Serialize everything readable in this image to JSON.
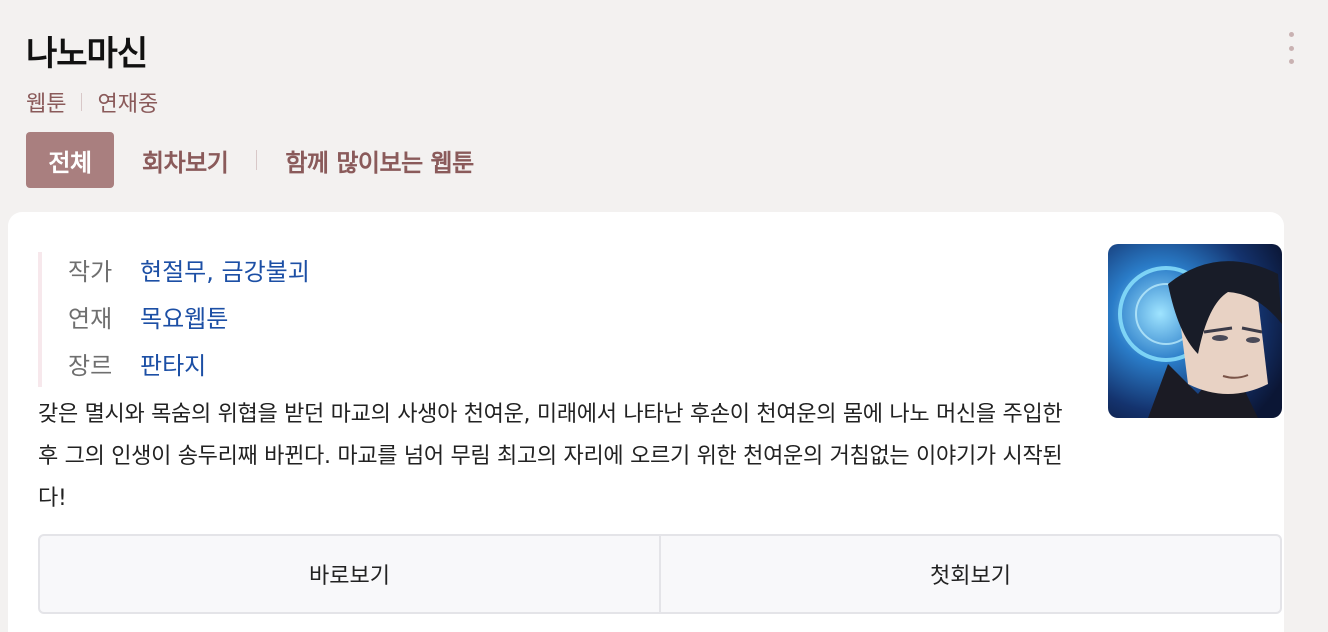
{
  "header": {
    "title": "나노마신",
    "more_icon": "vertical-dots-icon",
    "meta": [
      "웹툰",
      "연재중"
    ]
  },
  "tabs": [
    {
      "label": "전체",
      "active": true
    },
    {
      "label": "회차보기",
      "active": false
    },
    {
      "label": "함께 많이보는 웹툰",
      "active": false
    }
  ],
  "info": [
    {
      "label": "작가",
      "value": "현절무, 금강불괴"
    },
    {
      "label": "연재",
      "value": "목요웹툰"
    },
    {
      "label": "장르",
      "value": "판타지"
    }
  ],
  "description": "갖은 멸시와 목숨의 위협을 받던 마교의 사생아 천여운, 미래에서 나타난 후손이 천여운의 몸에 나노 머신을 주입한 후 그의 인생이 송두리째 바뀐다. 마교를 넘어 무림 최고의 자리에 오르기 위한 천여운의 거침없는 이야기가 시작된다!",
  "actions": {
    "read_now": "바로보기",
    "first_episode": "첫회보기"
  },
  "colors": {
    "accent": "#a97f7f",
    "link": "#1c4fa5",
    "background": "#f3f1f0"
  }
}
